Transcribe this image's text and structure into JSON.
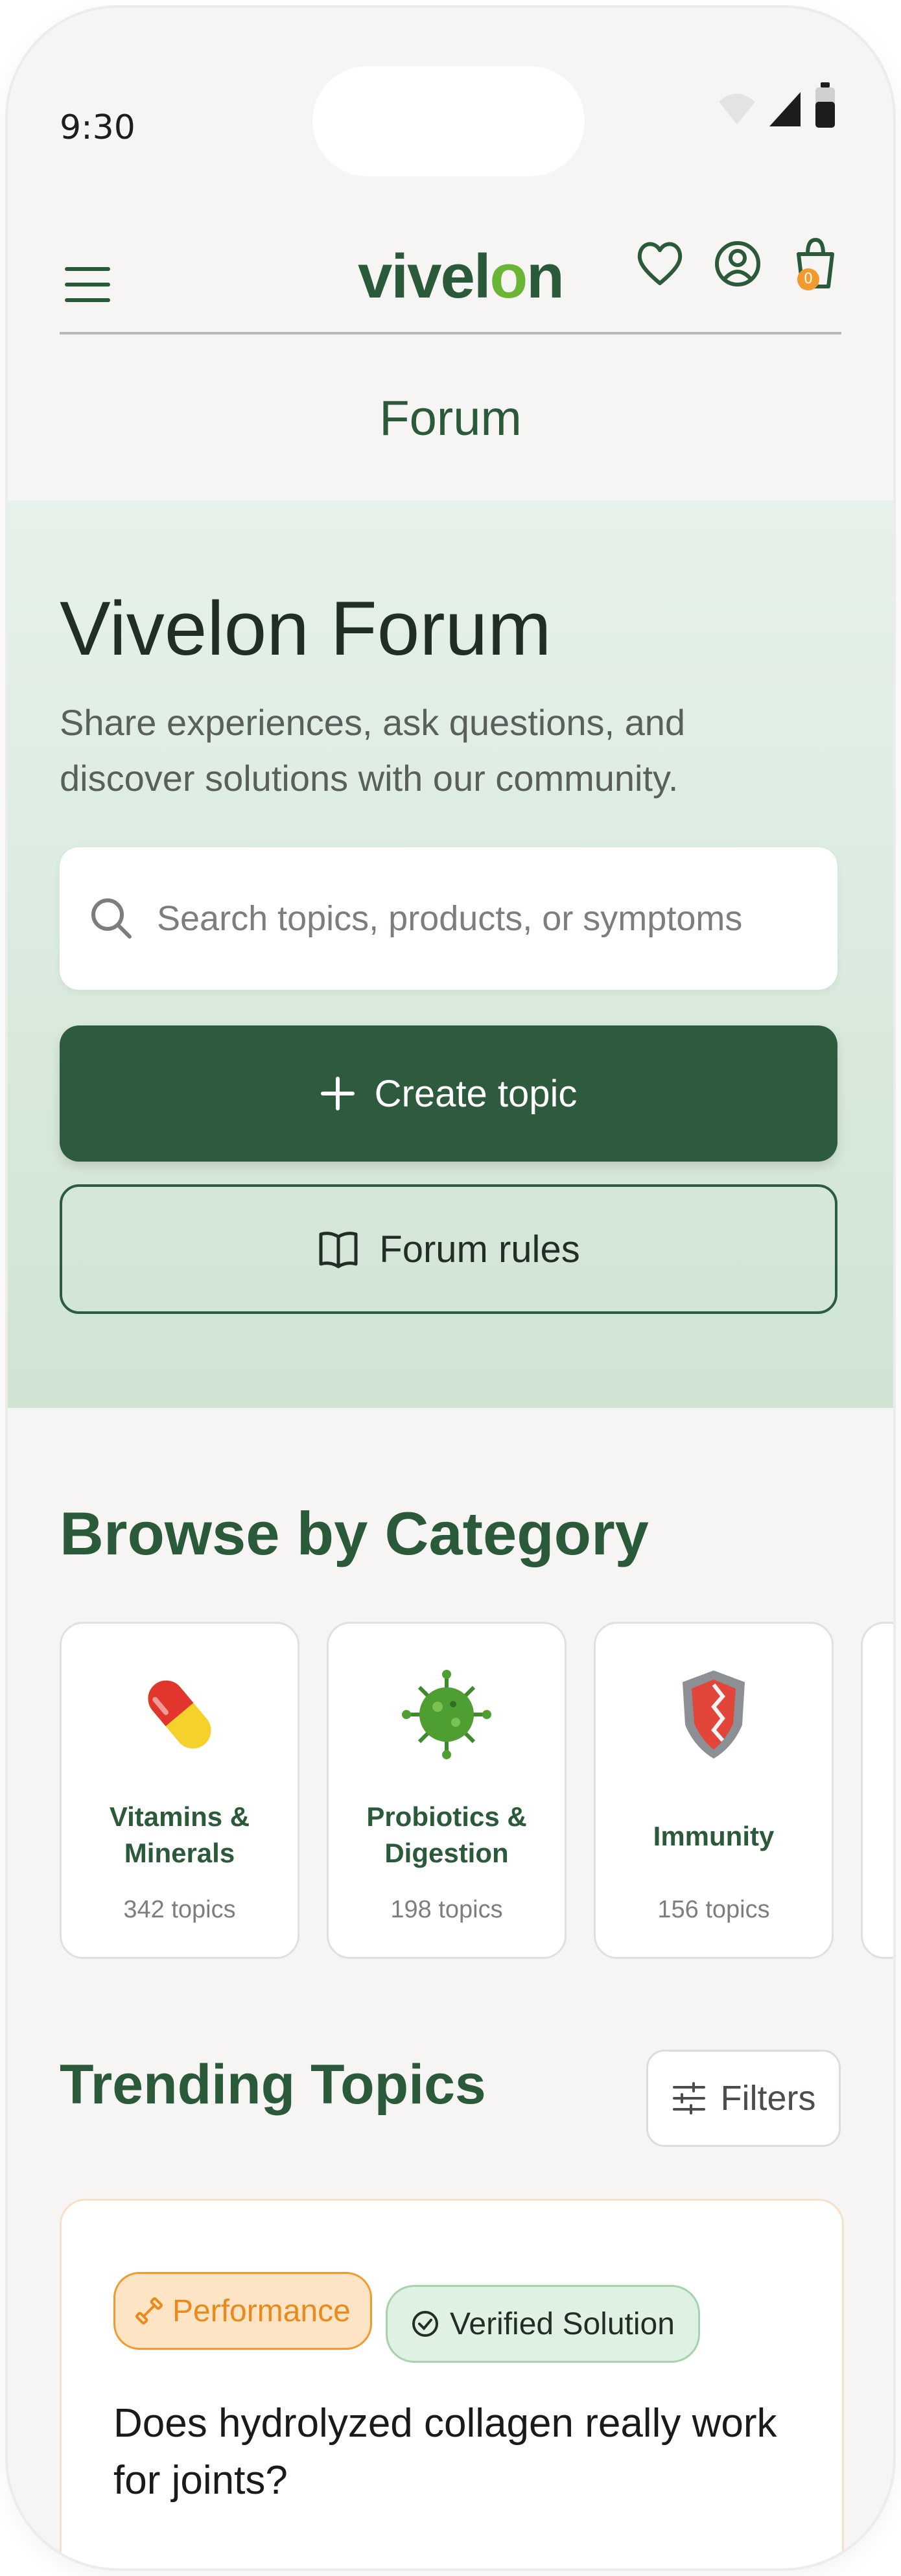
{
  "status_bar": {
    "time": "9:30"
  },
  "header": {
    "logo_prefix": "vivel",
    "logo_o": "o",
    "logo_suffix": "n",
    "cart_count": "0"
  },
  "page_title": "Forum",
  "hero": {
    "title": "Vivelon Forum",
    "subtitle": "Share experiences, ask questions, and discover solutions with our community.",
    "search_placeholder": "Search topics, products, or symptoms",
    "create_label": "Create topic",
    "rules_label": "Forum rules"
  },
  "categories": {
    "title": "Browse by Category",
    "items": [
      {
        "name": "Vitamins & Minerals",
        "count": "342 topics",
        "icon": "pill-icon"
      },
      {
        "name": "Probiotics & Digestion",
        "count": "198 topics",
        "icon": "bacteria-icon"
      },
      {
        "name": "Immunity",
        "count": "156 topics",
        "icon": "shield-icon"
      }
    ]
  },
  "trending": {
    "title": "Trending Topics",
    "filters_label": "Filters",
    "topics": [
      {
        "tag": "Performance",
        "badge": "Verified Solution",
        "title": "Does hydrolyzed collagen really work for joints?"
      }
    ]
  },
  "colors": {
    "brand_green": "#2b5a3a",
    "accent_orange": "#f29a2e",
    "leaf_green": "#6bb536"
  }
}
